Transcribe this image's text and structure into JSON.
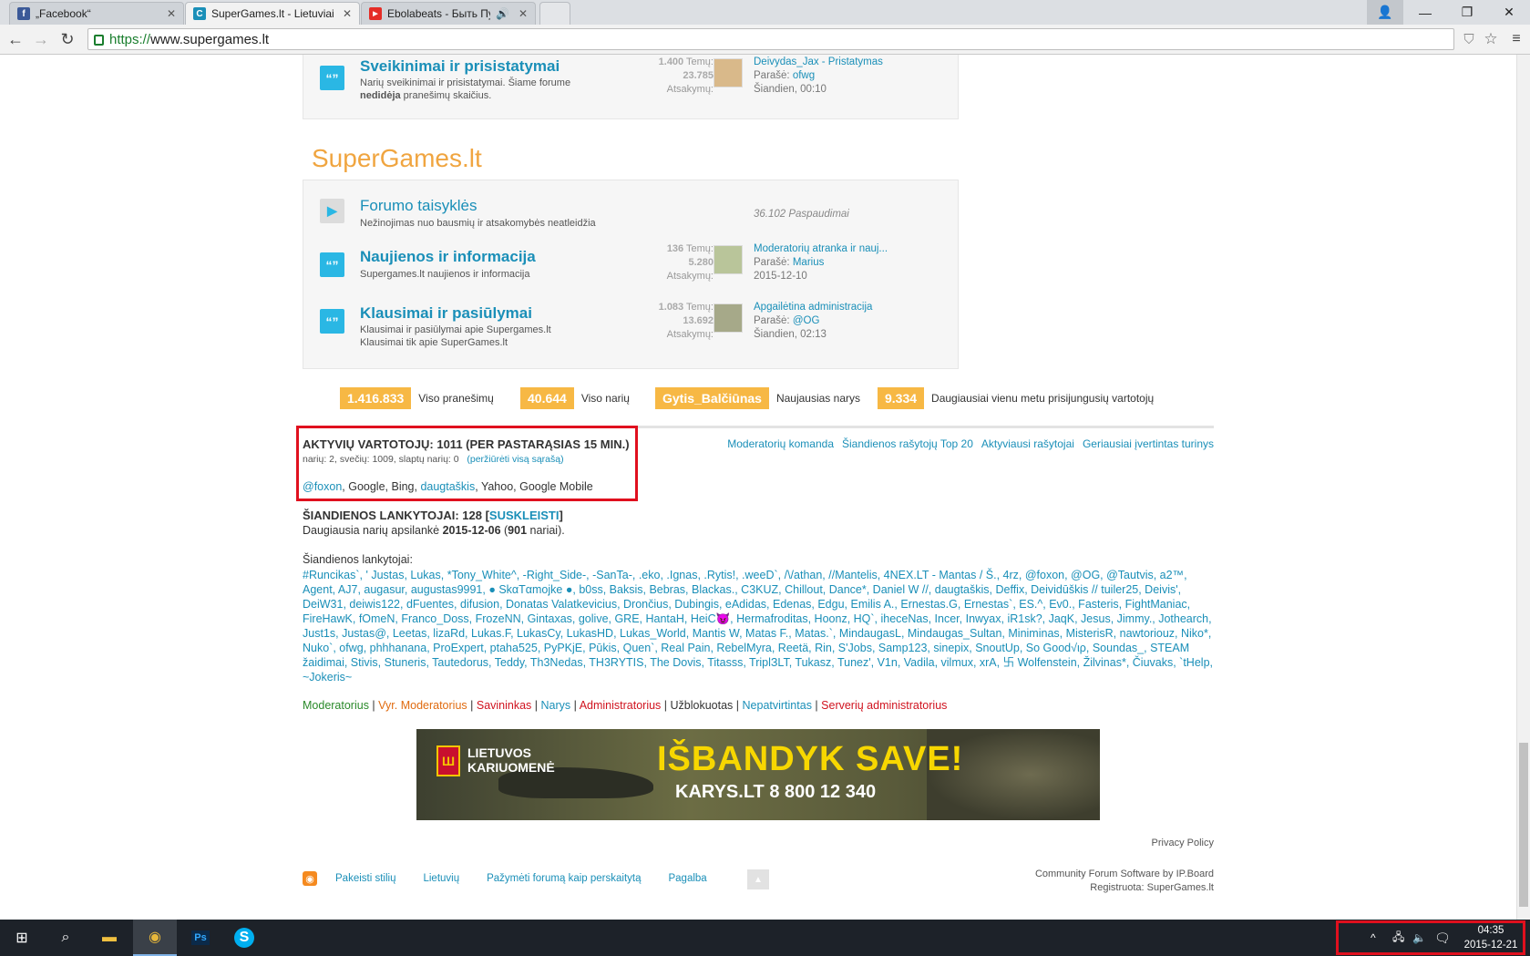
{
  "browser": {
    "tabs": [
      {
        "title": "„Facebook“",
        "favicon": "facebook-icon",
        "color": "#3b5998",
        "glyph": "f"
      },
      {
        "title": "SuperGames.lt - Lietuviai ž",
        "favicon": "supergames-icon",
        "color": "#1a8fb8",
        "glyph": "C"
      },
      {
        "title": "Ebolabeats - Быть Пуст",
        "favicon": "youtube-icon",
        "color": "#e52d27",
        "glyph": "▶"
      }
    ],
    "url_scheme": "https://",
    "url_host": "www.supergames.lt"
  },
  "forum_top": {
    "title": "Sveikinimai ir prisistatymai",
    "desc_1": "Narių sveikinimai ir prisistatymai. Šiame forume ",
    "desc_bold": "nedidėja",
    "desc_2": " pranešimų skaičius.",
    "topics_n": "1.400",
    "topics_lbl": "Temų:",
    "replies_n": "23.785",
    "replies_lbl": "Atsakymų:",
    "last_title": "Deivydas_Jax - Pristatymas",
    "posted_lbl": "Parašė:",
    "last_author": "ofwg",
    "last_time": "Šiandien, 00:10"
  },
  "section_title": "SuperGames.lt",
  "forums": [
    {
      "title": "Forumo taisyklės",
      "desc": "Nežinojimas nuo bausmių ir atsakomybės neatleidžia",
      "redirects": "36.102 Paspaudimai"
    },
    {
      "title": "Naujienos ir informacija",
      "desc": "Supergames.lt naujienos ir informacija",
      "topics_n": "136",
      "topics_lbl": "Temų:",
      "replies_n": "5.280",
      "replies_lbl": "Atsakymų:",
      "last_title": "Moderatorių atranka ir nauj...",
      "posted_lbl": "Parašė:",
      "last_author": "Marius",
      "last_time": "2015-12-10"
    },
    {
      "title": "Klausimai ir pasiūlymai",
      "desc": "Klausimai ir pasiūlymai apie Supergames.lt",
      "desc2": "Klausimai tik apie SuperGames.lt",
      "topics_n": "1.083",
      "topics_lbl": "Temų:",
      "replies_n": "13.692",
      "replies_lbl": "Atsakymų:",
      "last_title": "Apgailėtina administracija",
      "posted_lbl": "Parašė:",
      "last_author": "@OG",
      "last_time": "Šiandien, 02:13"
    }
  ],
  "stats": [
    {
      "value": "1.416.833",
      "label": "Viso pranešimų"
    },
    {
      "value": "40.644",
      "label": "Viso narių"
    },
    {
      "value": "Gytis_Balčiūnas",
      "label": "Naujausias narys"
    },
    {
      "value": "9.334",
      "label": "Daugiausiai vienu metu prisijungusių vartotojų"
    }
  ],
  "active": {
    "heading": "AKTYVIŲ VARTOTOJŲ: 1011 (PER PASTARĄSIAS 15 MIN.)",
    "sub": "narių: 2, svečių: 1009, slaptų narių: 0",
    "sub_link": "(peržiūrėti visą sąrašą)",
    "u1": "@foxon",
    "mid": ", Google, Bing, ",
    "u2": "daugtaškis",
    "end": ", Yahoo, Google Mobile"
  },
  "right_links": [
    "Moderatorių komanda",
    "Šiandienos rašytojų Top 20",
    "Aktyviausi rašytojai",
    "Geriausiai įvertintas turinys"
  ],
  "today": {
    "heading": "ŠIANDIENOS LANKYTOJAI: 128 [",
    "collapse": "SUSKLEISTI",
    "heading_end": "]",
    "most_1": "Daugiausia narių apsilankė ",
    "most_date": "2015-12-06",
    "most_2": " (",
    "most_n": "901",
    "most_3": " nariai).",
    "list_lbl": "Šiandienos lankytojai:",
    "list": "#Runcikas`, ' Justas, Lukas, *Tony_White^, -Right_Side-, -SanTa-, .eko, .Ignas, .Rytis!, .weeD`, /\\/athan, //Mantelis, 4NEX.LT - Mantas / Š., 4rz, @foxon, @OG, @Tautvis, a2™, Agent, AJ7, augasur, augustas9991, ● SkαTαmojke ●, b0ss, Baksis, Bebras, Blackas., C3KUZ, Chillout, Dance*, Daniel W //, daugtaškis, Deffix, Deividūškis // tuiler25, Deivis', DeiW31, deiwis122, dFuentes, difusion, Donatas Valatkevicius, Drončius, Dubingis, eAdidas, Edenas, Edgu, Emilis A., Ernestas.G, Ernestas`, ES.^, Ev0., Fasteris, FightManiac, FireHawK, fOmeN, Franco_Doss, FrozeNN, Gintaxas, golive, GRE, HantaH, HeiC😈, Hermafroditas, Hoonz, HQ`, iheceNas, Incer, Inwyax, iR1sk?, JaqK, Jesus, Jimmy., Jothearch, Just1s, Justas@, Leetas, lizaRd, Lukas.F, LukasCy, LukasHD, Lukas_World, Mantis W, Matas F., Matas.`, MindaugasL, Mindaugas_Sultan, Miniminas, MisterisR, nawtoriouz, Niko*, Nuko`, ofwg, phhhanana, ProExpert, ptaha525, PyPKjE, Pūkis, Quen`, Real Pain, RebelMyra, Reetä, Rin, S'Jobs, Samp123, sinepix, SnoutUp, So Good√ιρ, Soundas_, STEAM žaidimai, Stivis, Stuneris, Tautedorus, Teddy, Th3Nedas, TH3RYTIS, The Dovis, Titasss, TriplЗLT, Tukasz, Tunez', V1n, Vadila, vilmux, xrA, 卐 Wolfenstein, Žilvinas*, Čiuvaks, `tHelp, ~Jokeris~"
  },
  "legend": [
    {
      "label": "Moderatorius",
      "color": "#2a8a2a"
    },
    {
      "label": "Vyr. Moderatorius",
      "color": "#e06b10"
    },
    {
      "label": "Savininkas",
      "color": "#d0131f"
    },
    {
      "label": "Narys",
      "color": "#1a8fb8"
    },
    {
      "label": "Administratorius",
      "color": "#d0131f"
    },
    {
      "label": "Užblokuotas",
      "color": "#333333"
    },
    {
      "label": "Nepatvirtintas",
      "color": "#1a8fb8"
    },
    {
      "label": "Serverių administratorius",
      "color": "#d0131f"
    }
  ],
  "legend_sep": " | ",
  "banner": {
    "org_1": "LIETUVOS",
    "org_2": "KARIUOMENĖ",
    "headline": "IŠBANDYK SAVE!",
    "contact": "KARYS.LT   8 800 12 340"
  },
  "footer": {
    "privacy": "Privacy Policy",
    "links": [
      "Pakeisti stilių",
      "Lietuvių",
      "Pažymėti forumą kaip perskaitytą",
      "Pagalba"
    ],
    "software": "Community Forum Software by IP.Board",
    "registered": "Registruota: SuperGames.lt"
  },
  "taskbar": {
    "time": "04:35",
    "date": "2015-12-21"
  }
}
